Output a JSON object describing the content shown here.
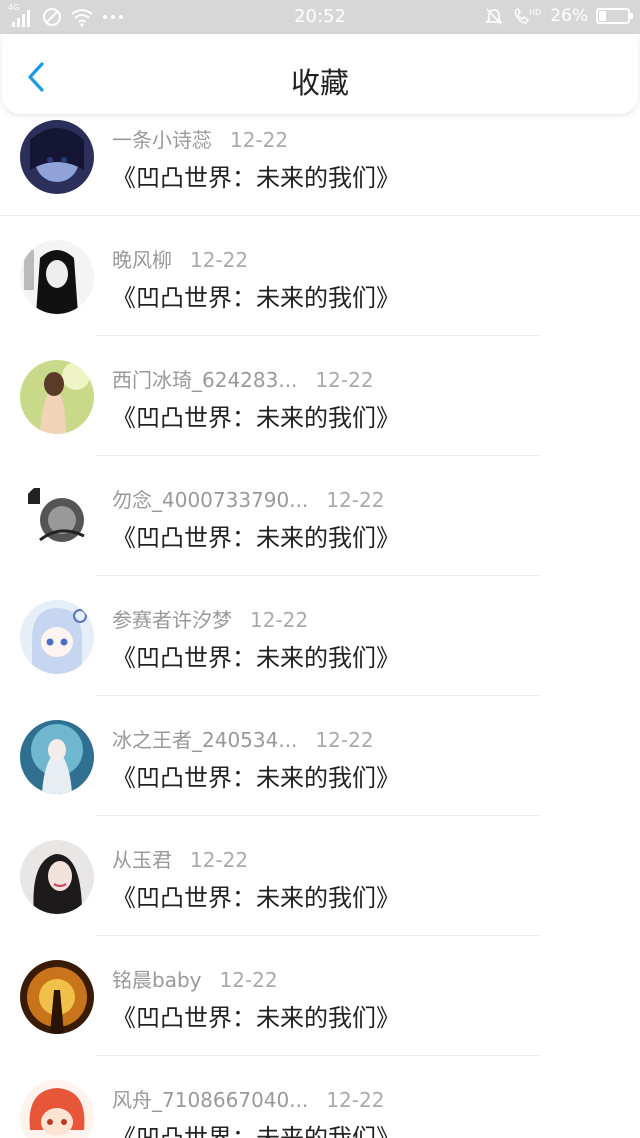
{
  "status_bar": {
    "network": "4G",
    "time": "20:52",
    "battery": "26%",
    "battery_level": 0.26,
    "icons": [
      "signal-icon",
      "no-sim-icon",
      "wifi-icon",
      "more-icon",
      "mute-icon",
      "hd-call-icon",
      "battery-icon"
    ]
  },
  "header": {
    "title": "收藏",
    "back_icon": "chevron-left-icon",
    "accent": "#1a9ae6"
  },
  "items": [
    {
      "user": "一条小诗蕊",
      "date": "12-22",
      "title": "《凹凸世界：未来的我们》"
    },
    {
      "user": "晚风柳",
      "date": "12-22",
      "title": "《凹凸世界：未来的我们》"
    },
    {
      "user": "西门冰琦_624283...",
      "date": "12-22",
      "title": "《凹凸世界：未来的我们》"
    },
    {
      "user": "勿念_4000733790...",
      "date": "12-22",
      "title": "《凹凸世界：未来的我们》"
    },
    {
      "user": "参赛者许汐梦",
      "date": "12-22",
      "title": "《凹凸世界：未来的我们》"
    },
    {
      "user": "冰之王者_240534...",
      "date": "12-22",
      "title": "《凹凸世界：未来的我们》"
    },
    {
      "user": "从玉君",
      "date": "12-22",
      "title": "《凹凸世界：未来的我们》"
    },
    {
      "user": "铭晨baby",
      "date": "12-22",
      "title": "《凹凸世界：未来的我们》"
    },
    {
      "user": "风舟_7108667040...",
      "date": "12-22",
      "title": "《凹凸世界：未来的我们》"
    }
  ]
}
